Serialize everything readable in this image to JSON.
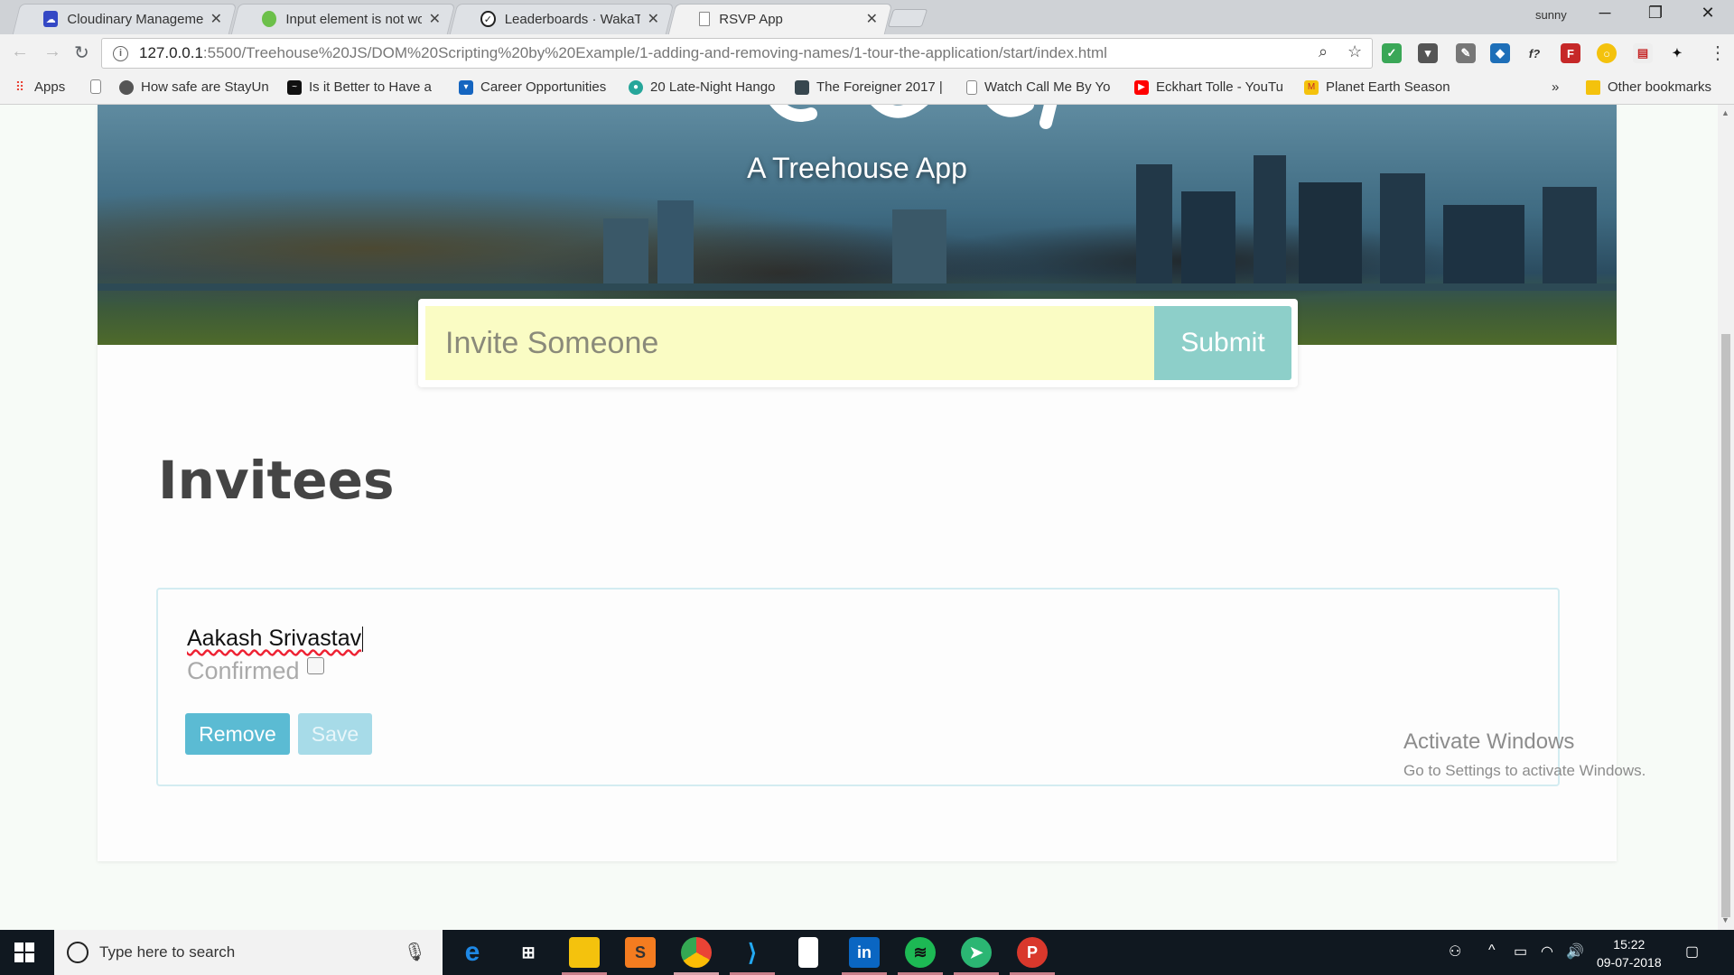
{
  "browser": {
    "tabs": [
      {
        "title": "Cloudinary Management",
        "icon_color": "#3448c5",
        "active": false
      },
      {
        "title": "Input element is not worki",
        "icon_color": "#6cc04a",
        "active": false
      },
      {
        "title": "Leaderboards · WakaTime",
        "icon_color": "#222222",
        "active": false
      },
      {
        "title": "RSVP App",
        "icon_color": "#888888",
        "active": true
      }
    ],
    "profile": "sunny",
    "url_host": "127.0.0.1",
    "url_path": ":5500/Treehouse%20JS/DOM%20Scripting%20by%20Example/1-adding-and-removing-names/1-tour-the-application/start/index.html",
    "bookmarks": [
      {
        "label": "Apps",
        "color": "#e94235"
      },
      {
        "label": "",
        "color": "#9e9e9e"
      },
      {
        "label": "How safe are StayUn",
        "color": "#555555"
      },
      {
        "label": "Is it Better to Have a",
        "color": "#111111"
      },
      {
        "label": "Career Opportunities",
        "color": "#1565c0"
      },
      {
        "label": "20 Late-Night Hango",
        "color": "#26a69a"
      },
      {
        "label": "The Foreigner 2017 |",
        "color": "#37474f"
      },
      {
        "label": "Watch Call Me By Yo",
        "color": "#9e9e9e"
      },
      {
        "label": "Eckhart Tolle - YouTu",
        "color": "#ff0000"
      },
      {
        "label": "Planet Earth Season",
        "color": "#f4c20d"
      }
    ],
    "overflow": "»",
    "other_bookmarks": "Other bookmarks"
  },
  "app": {
    "subtitle": "A Treehouse App",
    "form": {
      "placeholder": "Invite Someone",
      "submit_label": "Submit"
    },
    "invitees_heading": "Invitees",
    "invitees": [
      {
        "name": "Aakash Srivastav",
        "confirmed_label": "Confirmed",
        "remove_label": "Remove",
        "save_label": "Save"
      }
    ]
  },
  "watermark": {
    "line1": "Activate Windows",
    "line2": "Go to Settings to activate Windows."
  },
  "taskbar": {
    "search_placeholder": "Type here to search",
    "time": "15:22",
    "date": "09-07-2018"
  },
  "colors": {
    "input_bg": "#fafcc4",
    "submit_bg": "#8dcfc9",
    "remove_bg": "#5bbbd3",
    "save_bg": "#a7dbe8"
  }
}
